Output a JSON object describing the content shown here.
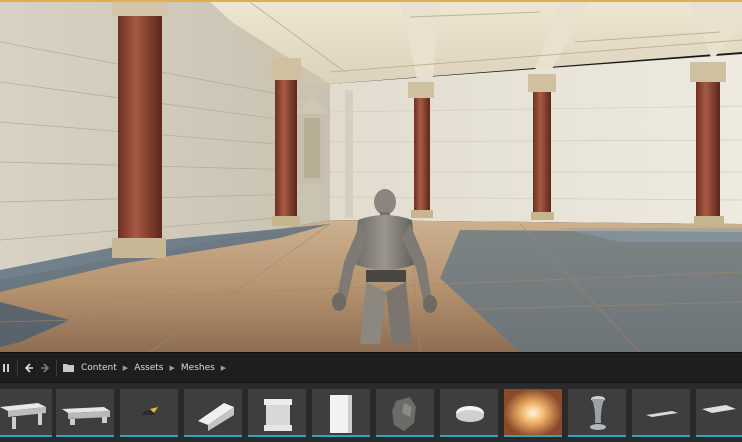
{
  "editor": {
    "accent_color": "#d8b24a",
    "asset_underline_color": "#33a3c4"
  },
  "content_browser": {
    "collapse_icon": "panel-toggle-icon",
    "back_icon": "arrow-left-icon",
    "forward_icon": "arrow-right-icon",
    "folder_icon": "folder-icon",
    "breadcrumb": [
      "Content",
      "Assets",
      "Meshes"
    ],
    "breadcrumb_separator_icon": "chevron-right-icon"
  },
  "assets": [
    {
      "icon": "bench-slab-mesh-icon"
    },
    {
      "icon": "bench-mesh-icon"
    },
    {
      "icon": "small-prop-mesh-icon"
    },
    {
      "icon": "wedge-block-mesh-icon"
    },
    {
      "icon": "pedestal-mesh-icon"
    },
    {
      "icon": "tall-block-mesh-icon"
    },
    {
      "icon": "rock-mesh-icon"
    },
    {
      "icon": "round-disc-mesh-icon"
    },
    {
      "icon": "light-burst-icon"
    },
    {
      "icon": "vase-mesh-icon"
    },
    {
      "icon": "flat-plane-mesh-icon"
    },
    {
      "icon": "partial-mesh-icon"
    }
  ]
}
